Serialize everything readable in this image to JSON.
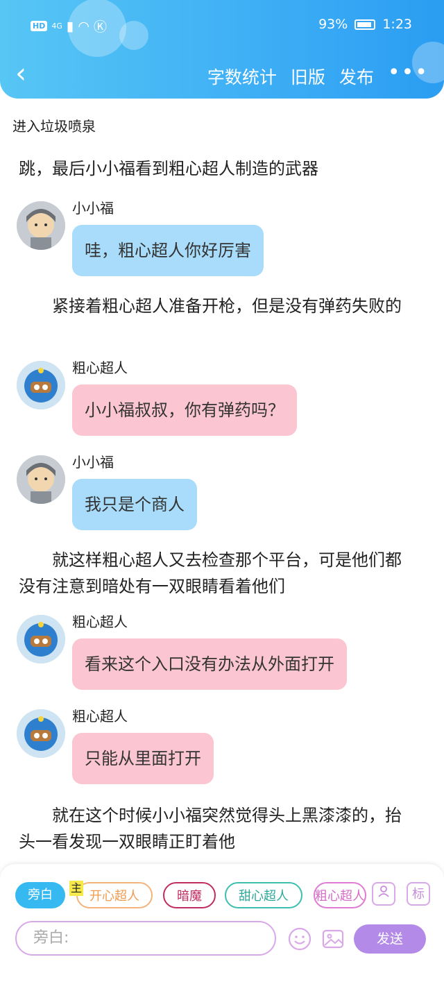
{
  "status_bar": {
    "hd": "HD",
    "net": "4G",
    "battery": "93%",
    "time": "1:23"
  },
  "nav": {
    "back_glyph": "‹",
    "actions": [
      "字数统计",
      "旧版",
      "发布"
    ],
    "more_glyph": "•••"
  },
  "chapter_title": "进入垃圾喷泉",
  "feed": [
    {
      "type": "narration",
      "text": "跳，最后小小福看到粗心超人制造的武器"
    },
    {
      "type": "message",
      "speaker": "小小福",
      "text": "哇，粗心超人你好厉害",
      "color": "blue"
    },
    {
      "type": "narration",
      "text": "紧接着粗心超人准备开枪，但是没有弹药失败的"
    },
    {
      "type": "message",
      "speaker": "粗心超人",
      "text": "小小福叔叔，你有弹药吗？",
      "color": "pink"
    },
    {
      "type": "message",
      "speaker": "小小福",
      "text": "我只是个商人",
      "color": "blue"
    },
    {
      "type": "narration",
      "text": "就这样粗心超人又去检查那个平台，可是他们都没有注意到暗处有一双眼睛看着他们"
    },
    {
      "type": "message",
      "speaker": "粗心超人",
      "text": "看来这个入口没有办法从外面打开",
      "color": "pink"
    },
    {
      "type": "message",
      "speaker": "粗心超人",
      "text": "只能从里面打开",
      "color": "pink"
    },
    {
      "type": "narration",
      "text": "就在这个时候小小福突然觉得头上黑漆漆的，抬头一看发现一双眼睛正盯着他"
    }
  ],
  "composer": {
    "roles": [
      "旁白",
      "开心超人",
      "暗魔",
      "甜心超人",
      "粗心超人"
    ],
    "main_badge": "主",
    "placeholder": "旁白:",
    "send_label": "发送",
    "icons": {
      "person": "person-icon",
      "tag": "标",
      "emoji": "emoji-icon",
      "image": "image-icon"
    }
  },
  "colors": {
    "header": "#3fb0f5",
    "bubble_blue": "#a8dcfa",
    "bubble_pink": "#fbc6d2",
    "send": "#b48ae8"
  }
}
